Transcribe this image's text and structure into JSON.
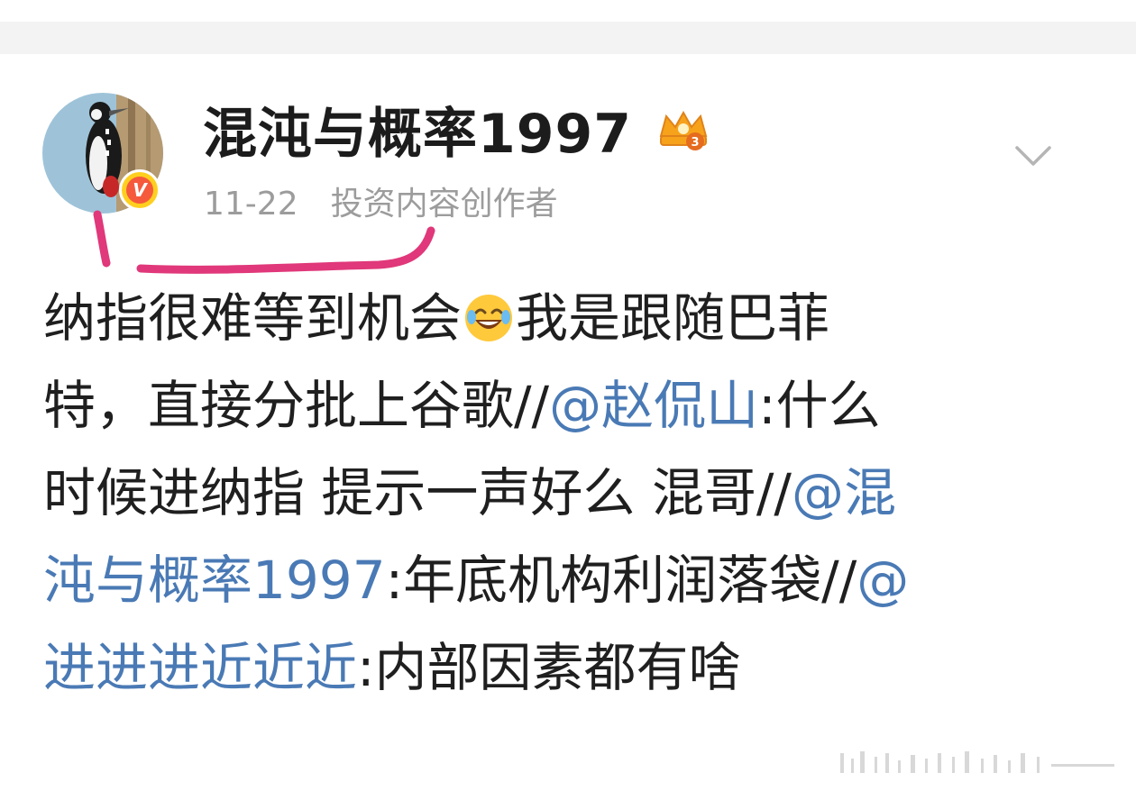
{
  "post": {
    "author": {
      "name": "混沌与概率1997",
      "level_badge_icon": "crown-level-3-icon",
      "verified_icon": "verified-v-badge-icon",
      "verified_letter": "V",
      "verified_color": "#f55a3c"
    },
    "date": "11-22",
    "author_tag": "投资内容创作者",
    "chevron_icon": "chevron-down-icon",
    "emoji_icon": "laugh-cry-emoji",
    "content": {
      "line1a": "纳指很难等到机会",
      "line1b": "我是跟随巴菲",
      "line2a": "特，直接分批上谷歌//",
      "mention1": "@赵侃山",
      "line2b": ":什么",
      "line3a": "时候进纳指 提示一声好么 混哥//",
      "mention2a": "@混",
      "mention2b": "沌与概率1997",
      "line4a": ":年底机构利润落袋//",
      "mention3a": "@",
      "mention3b": "进进进近近近",
      "line5a": ":内部因素都有啥"
    }
  },
  "colors": {
    "mention": "#4a7ab5",
    "annotation_stroke": "#e0387a",
    "meta_gray": "#9c9c9c"
  }
}
